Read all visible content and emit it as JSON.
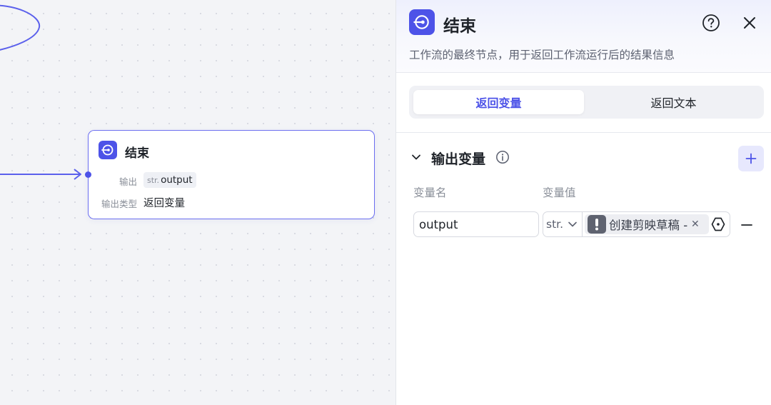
{
  "canvas": {
    "end_node": {
      "title": "结束",
      "output_label": "输出",
      "output_type_short": "str.",
      "output_name": "output",
      "output_type_label": "输出类型",
      "output_type_value": "返回变量"
    }
  },
  "panel": {
    "title": "结束",
    "description": "工作流的最终节点，用于返回工作流运行后的结果信息",
    "tabs": [
      {
        "label": "返回变量",
        "active": true
      },
      {
        "label": "返回文本",
        "active": false
      }
    ],
    "section": {
      "title": "输出变量",
      "columns": {
        "name": "变量名",
        "value": "变量值"
      },
      "rows": [
        {
          "name": "output",
          "type": "str.",
          "reference_label": "创建剪映草稿 - output"
        }
      ]
    }
  },
  "colors": {
    "accent": "#4d53e8",
    "node_border": "#6b6ef0",
    "add_button_bg": "#e7e8fd"
  },
  "icons": {
    "node_icon": "end-node-icon",
    "help": "question-circle-icon",
    "close": "close-icon",
    "collapse": "chevron-down-icon",
    "info": "info-icon",
    "add": "plus-icon",
    "warning": "exclamation-icon",
    "clear": "clear-x-icon",
    "picker": "variable-picker-icon",
    "remove": "minus-icon"
  }
}
